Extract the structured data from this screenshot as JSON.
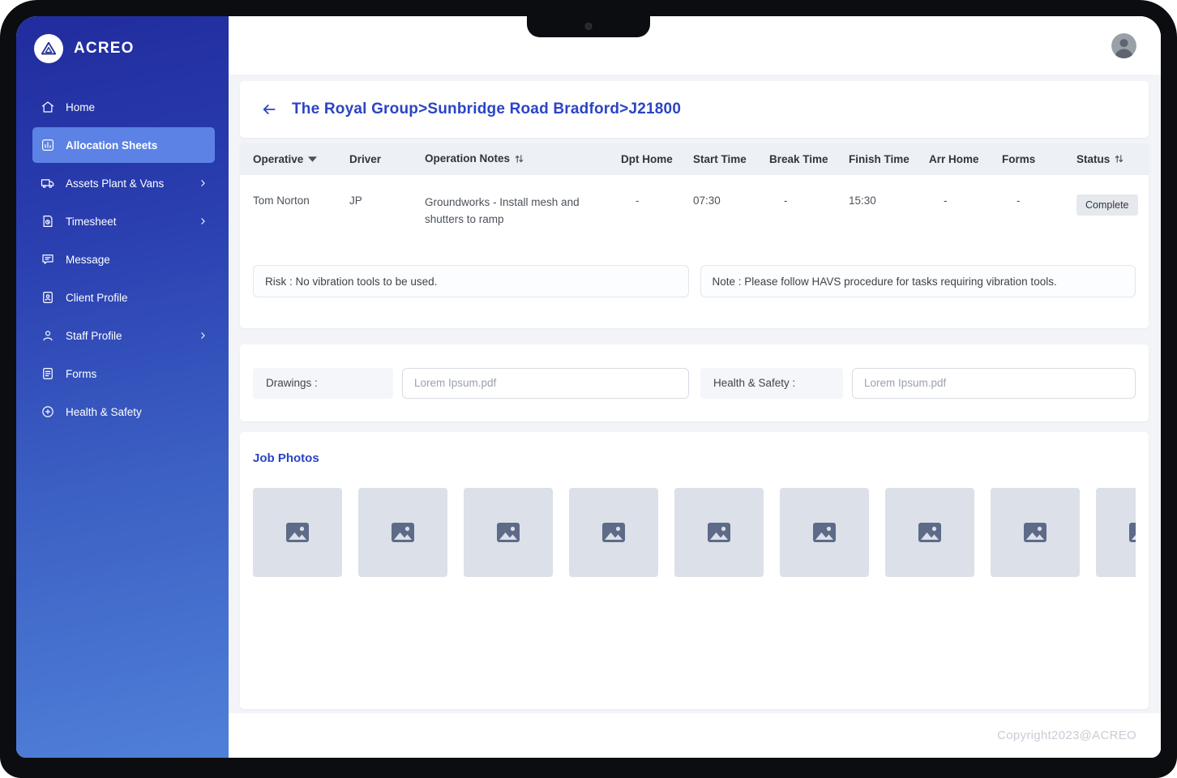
{
  "colors": {
    "accent_blue": "#2b44c5",
    "sidebar_gradient_top": "#212c9e",
    "sidebar_gradient_bottom": "#4f80d8",
    "active_item_bg": "#5b82e4",
    "badge_bg": "#e5e8ed",
    "photo_placeholder_bg": "#dce0e8"
  },
  "sidebar": {
    "brand": "ACREO",
    "items": [
      {
        "label": "Home",
        "icon": "home-icon",
        "active": false,
        "chevron": false
      },
      {
        "label": "Allocation Sheets",
        "icon": "allocation-sheets-icon",
        "active": true,
        "chevron": false
      },
      {
        "label": "Assets Plant & Vans",
        "icon": "truck-icon",
        "active": false,
        "chevron": true
      },
      {
        "label": "Timesheet",
        "icon": "timesheet-icon",
        "active": false,
        "chevron": true
      },
      {
        "label": "Message",
        "icon": "message-icon",
        "active": false,
        "chevron": false
      },
      {
        "label": "Client Profile",
        "icon": "client-profile-icon",
        "active": false,
        "chevron": false
      },
      {
        "label": "Staff Profile",
        "icon": "staff-profile-icon",
        "active": false,
        "chevron": true
      },
      {
        "label": "Forms",
        "icon": "forms-icon",
        "active": false,
        "chevron": false
      },
      {
        "label": "Health & Safety",
        "icon": "health-safety-icon",
        "active": false,
        "chevron": false
      }
    ]
  },
  "breadcrumb": {
    "title": "The Royal Group>Sunbridge Road Bradford>J21800"
  },
  "table": {
    "columns": {
      "operative": "Operative",
      "driver": "Driver",
      "operation_notes": "Operation Notes",
      "dpt_home": "Dpt Home",
      "start_time": "Start Time",
      "break_time": "Break Time",
      "finish_time": "Finish Time",
      "arr_home": "Arr Home",
      "forms": "Forms",
      "status": "Status"
    },
    "rows": [
      {
        "operative": "Tom Norton",
        "driver": "JP",
        "operation_notes": "Groundworks - Install mesh and shutters to ramp",
        "dpt_home": "-",
        "start_time": "07:30",
        "break_time": "-",
        "finish_time": "15:30",
        "arr_home": "-",
        "forms": "-",
        "status": "Complete"
      }
    ]
  },
  "notes": {
    "risk": "Risk : No vibration tools to be used.",
    "note": "Note : Please follow HAVS procedure for tasks requiring vibration tools."
  },
  "attachments": {
    "drawings_label": "Drawings :",
    "drawings_file": "Lorem Ipsum.pdf",
    "health_safety_label": "Health & Safety :",
    "health_safety_file": "Lorem Ipsum.pdf"
  },
  "job_photos": {
    "title": "Job Photos",
    "placeholder_count": 9
  },
  "footer": {
    "copyright": "Copyright2023@ACREO"
  }
}
